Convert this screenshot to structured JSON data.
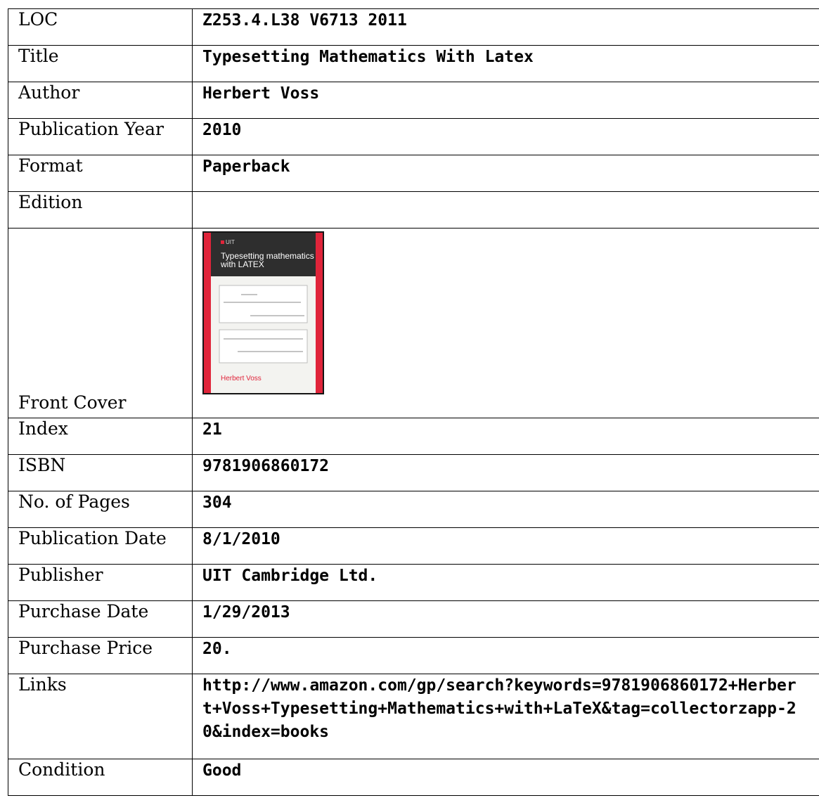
{
  "rows": [
    {
      "label": "LOC",
      "value": "Z253.4.L38 V6713 2011"
    },
    {
      "label": "Title",
      "value": "Typesetting Mathematics With Latex"
    },
    {
      "label": "Author",
      "value": "Herbert Voss"
    },
    {
      "label": "Publication Year",
      "value": "2010"
    },
    {
      "label": "Format",
      "value": "Paperback"
    },
    {
      "label": "Edition",
      "value": ""
    },
    {
      "label": "Front Cover"
    },
    {
      "label": "Index",
      "value": "21"
    },
    {
      "label": "ISBN",
      "value": "9781906860172"
    },
    {
      "label": "No. of Pages",
      "value": "304"
    },
    {
      "label": "Publication Date",
      "value": "8/1/2010"
    },
    {
      "label": "Publisher",
      "value": "UIT Cambridge Ltd."
    },
    {
      "label": "Purchase Date",
      "value": "1/29/2013"
    },
    {
      "label": "Purchase Price",
      "value": "20."
    },
    {
      "label": "Links",
      "value": "http://www.amazon.com/gp/search?keywords=9781906860172+Herbert+Voss+Typesetting+Mathematics+with+LaTeX&tag=collectorzapp-20&index=books"
    },
    {
      "label": "Condition",
      "value": "Good"
    }
  ],
  "cover": {
    "publisher_mark": "UIT",
    "title_line1": "Typesetting mathematics",
    "title_line2": "with LATEX",
    "author": "Herbert Voss",
    "colors": {
      "bar": "#e0243a",
      "dark": "#2e2e2e",
      "panel": "#f3f3f0"
    }
  }
}
